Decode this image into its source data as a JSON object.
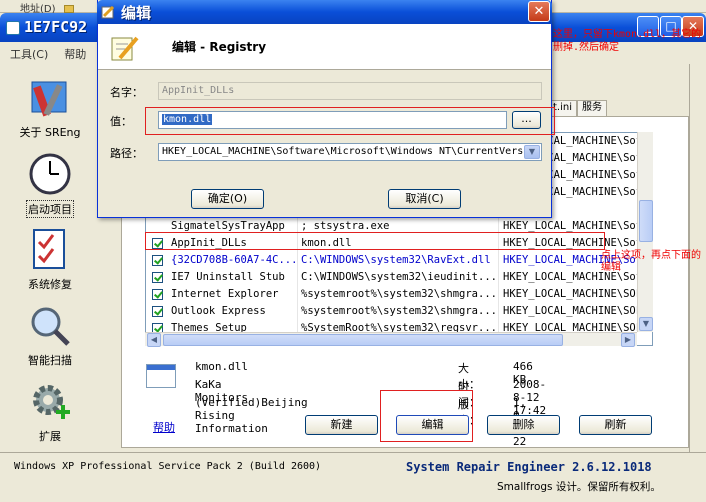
{
  "background": {
    "address_label": "地址(D)"
  },
  "main_window": {
    "title": "1E7FC92",
    "menu": [
      "工具(C)",
      "帮助"
    ],
    "sidebar": [
      {
        "label": "关于 SREng",
        "icon": "tools-icon"
      },
      {
        "label": "启动项目",
        "icon": "clock-icon"
      },
      {
        "label": "系统修复",
        "icon": "checklist-icon"
      },
      {
        "label": "智能扫描",
        "icon": "magnifier-icon"
      },
      {
        "label": "扩展",
        "icon": "gear-plus-icon"
      }
    ],
    "tabs": [
      "t.ini",
      "服务"
    ],
    "list_rows": [
      {
        "name": "SigmatelSysTrayApp",
        "command": "; stsystra.exe",
        "location": "HKEY_LOCAL_MACHINE\\Sof",
        "checked": false,
        "blue": false
      },
      {
        "name": "AppInit_DLLs",
        "command": "kmon.dll",
        "location": "HKEY_LOCAL_MACHINE\\Sof",
        "checked": true,
        "blue": false
      },
      {
        "name": "{32CD708B-60A7-4C...",
        "command": "C:\\WINDOWS\\system32\\RavExt.dll",
        "location": "HKEY_LOCAL_MACHINE\\Sof",
        "checked": true,
        "blue": true
      },
      {
        "name": "IE7 Uninstall Stub",
        "command": "C:\\WINDOWS\\system32\\ieudinit...",
        "location": "HKEY_LOCAL_MACHINE\\Sof",
        "checked": true,
        "blue": false
      },
      {
        "name": "Internet Explorer",
        "command": "%systemroot%\\system32\\shmgra...",
        "location": "HKEY_LOCAL_MACHINE\\SOF",
        "checked": true,
        "blue": false
      },
      {
        "name": "Outlook Express",
        "command": "%systemroot%\\system32\\shmgra...",
        "location": "HKEY_LOCAL_MACHINE\\SOF",
        "checked": true,
        "blue": false
      },
      {
        "name": "Themes Setup",
        "command": "%SystemRoot%\\system32\\regsvr...",
        "location": "HKEY_LOCAL_MACHINE\\SOF",
        "checked": true,
        "blue": false
      }
    ],
    "hidden_rows_right": [
      "HKEY_LOCAL_MACHINE\\Sof",
      "HKEY_LOCAL_MACHINE\\Sof",
      "HKEY_LOCAL_MACHINE\\Sof",
      "HKEY_LOCAL_MACHINE\\Sof"
    ],
    "info": {
      "file": "kmon.dll",
      "company": "KaKa Monitors",
      "signer": "(Verified)Beijing Rising Information",
      "size_label": "大小：",
      "size": "466 KB",
      "time_label": "时间：",
      "time": "2008-8-12 17:42",
      "version_label": "版本：",
      "version": "1, 0, 0, 22"
    },
    "help_link": "帮助",
    "buttons": {
      "new": "新建",
      "edit": "编辑",
      "delete": "删除",
      "refresh": "刷新"
    },
    "status": {
      "os": "Windows XP Professional Service Pack 2 (Build 2600)",
      "product": "System Repair Engineer 2.6.12.1018",
      "copyright": "Smallfrogs 设计。保留所有权利。"
    }
  },
  "annotations": {
    "top": "这里，只留下kmon.dll，其它的删掉.然后确定",
    "right": "点上这项，再点下面的编辑"
  },
  "dialog": {
    "title": "编辑",
    "heading": "编辑 - Registry",
    "name_label": "名字：",
    "name_value": "AppInit_DLLs",
    "value_label": "值：",
    "value_value": "kmon.dll",
    "browse_label": "...",
    "path_label": "路径：",
    "path_value": "HKEY_LOCAL_MACHINE\\Software\\Microsoft\\Windows NT\\CurrentVers",
    "ok_label": "确定(O)",
    "cancel_label": "取消(C)"
  }
}
